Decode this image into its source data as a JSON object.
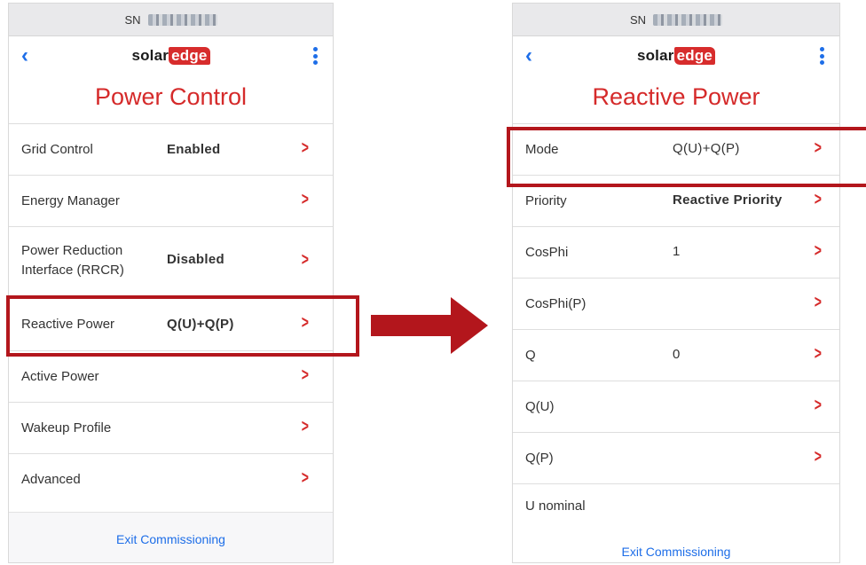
{
  "left": {
    "sn_label": "SN",
    "logo_solar": "solar",
    "logo_edge": "edge",
    "title": "Power Control",
    "rows": [
      {
        "label": "Grid Control",
        "value": "Enabled"
      },
      {
        "label": "Energy Manager",
        "value": ""
      },
      {
        "label": "Power Reduction\nInterface (RRCR)",
        "value": "Disabled"
      },
      {
        "label": "Reactive Power",
        "value": "Q(U)+Q(P)"
      },
      {
        "label": "Active Power",
        "value": ""
      },
      {
        "label": "Wakeup Profile",
        "value": ""
      },
      {
        "label": "Advanced",
        "value": ""
      }
    ],
    "footer": "Exit Commissioning"
  },
  "right": {
    "sn_label": "SN",
    "logo_solar": "solar",
    "logo_edge": "edge",
    "title": "Reactive Power",
    "rows": [
      {
        "label": "Mode",
        "value": "Q(U)+Q(P)"
      },
      {
        "label": "Priority",
        "value": "Reactive Priority"
      },
      {
        "label": "CosPhi",
        "value": "1"
      },
      {
        "label": "CosPhi(P)",
        "value": ""
      },
      {
        "label": "Q",
        "value": "0"
      },
      {
        "label": "Q(U)",
        "value": ""
      },
      {
        "label": "Q(P)",
        "value": ""
      },
      {
        "label": "U nominal",
        "value": ""
      }
    ],
    "footer": "Exit Commissioning"
  },
  "colors": {
    "accent_red": "#d52a2a",
    "link_blue": "#1e6ee8",
    "highlight": "#b3161c"
  },
  "icons": {
    "back": "chevron-left-icon",
    "menu": "kebab-menu-icon",
    "row": "chevron-right-icon",
    "arrow": "right-arrow-icon"
  }
}
